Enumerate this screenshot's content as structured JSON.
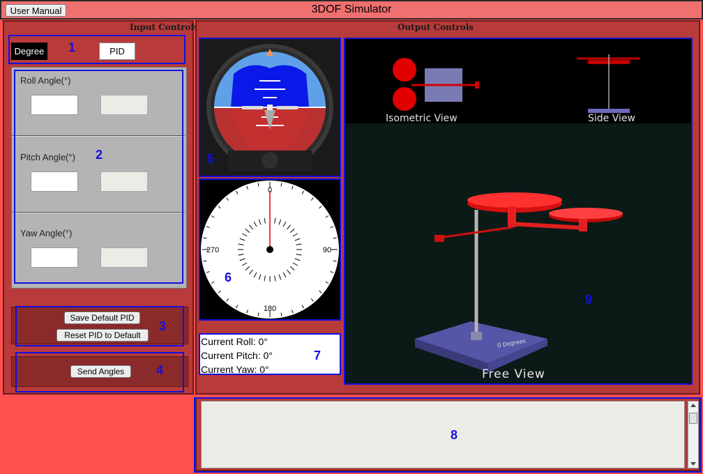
{
  "header": {
    "title": "3DOF Simulator",
    "manual_button": "User Manual"
  },
  "input_controls": {
    "title": "Input Controls",
    "tabs": {
      "degree": "Degree",
      "pid": "PID"
    },
    "angles": {
      "roll": {
        "label": "Roll Angle(°)",
        "value": "",
        "pid_value": ""
      },
      "pitch": {
        "label": "Pitch Angle(°)",
        "value": "",
        "pid_value": ""
      },
      "yaw": {
        "label": "Yaw Angle(°)",
        "value": "",
        "pid_value": ""
      }
    },
    "buttons": {
      "save_pid": "Save Default PID",
      "reset_pid": "Reset PID to Default",
      "send_angles": "Send Angles"
    }
  },
  "output_controls": {
    "title": "Output Controls",
    "compass": {
      "north": "0",
      "east": "90",
      "south": "180",
      "west": "270",
      "heading_deg": 0
    },
    "readouts": {
      "roll": "Current Roll: 0°",
      "pitch": "Current Pitch: 0°",
      "yaw": "Current Yaw: 0°"
    },
    "views": {
      "isometric": "Isometric View",
      "side": "Side View",
      "free": "Free View",
      "base_label": "0 Degrees"
    }
  },
  "log": {
    "value": ""
  },
  "annotations": {
    "n1": "1",
    "n2": "2",
    "n3": "3",
    "n4": "4",
    "n5": "5",
    "n6": "6",
    "n7": "7",
    "n8": "8",
    "n9": "9"
  },
  "colors": {
    "background": "#ff5050",
    "panel": "#b83a3a",
    "annotation": "#1010e0"
  }
}
